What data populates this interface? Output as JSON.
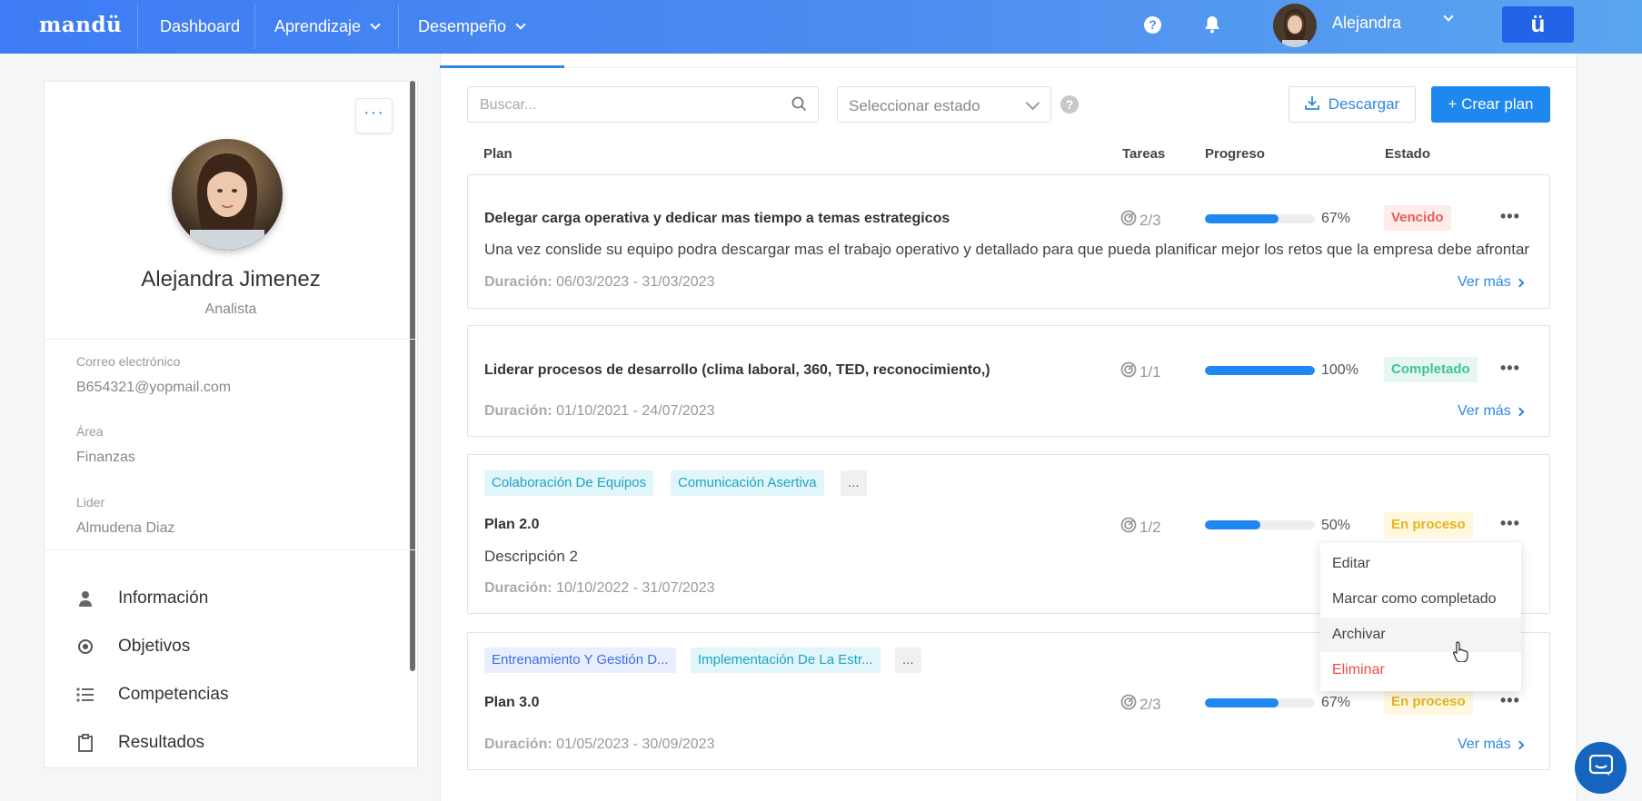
{
  "topbar": {
    "logo": "mandü",
    "nav": [
      {
        "label": "Dashboard"
      },
      {
        "label": "Aprendizaje"
      },
      {
        "label": "Desempeño"
      }
    ],
    "user_name": "Alejandra",
    "brand_badge": "ü"
  },
  "profile": {
    "name": "Alejandra Jimenez",
    "role": "Analista",
    "fields": [
      {
        "label": "Correo electrónico",
        "value": "B654321@yopmail.com"
      },
      {
        "label": "Área",
        "value": "Finanzas"
      },
      {
        "label": "Lider",
        "value": "Almudena Diaz"
      }
    ],
    "menu": [
      {
        "label": "Información",
        "icon": "person-icon"
      },
      {
        "label": "Objetivos",
        "icon": "target-icon"
      },
      {
        "label": "Competencias",
        "icon": "list-icon"
      },
      {
        "label": "Resultados",
        "icon": "clipboard-icon"
      }
    ]
  },
  "toolbar": {
    "search_placeholder": "Buscar...",
    "state_placeholder": "Seleccionar estado",
    "help": "?",
    "download_label": "Descargar",
    "create_label": "+ Crear plan"
  },
  "table": {
    "headers": {
      "plan": "Plan",
      "tasks": "Tareas",
      "progress": "Progreso",
      "state": "Estado"
    },
    "duration_label": "Duración:",
    "more_label": "Ver más",
    "plans": [
      {
        "title": "Delegar carga operativa y dedicar mas tiempo a temas estrategicos",
        "description": "Una vez conslide su equipo podra descargar mas el trabajo operativo y detallado para que pueda planificar mejor los retos que la empresa debe afrontar",
        "duration": "06/03/2023 - 31/03/2023",
        "tasks": "2/3",
        "progress": 67,
        "progress_label": "67%",
        "status": "Vencido",
        "status_color": "#e75c5c",
        "tags": []
      },
      {
        "title": "Liderar procesos de desarrollo (clima laboral, 360, TED, reconocimiento,)",
        "description": "",
        "duration": "01/10/2021 - 24/07/2023",
        "tasks": "1/1",
        "progress": 100,
        "progress_label": "100%",
        "status": "Completado",
        "status_color": "#3fc29c",
        "tags": []
      },
      {
        "title": "Plan 2.0",
        "description": "Descripción 2",
        "duration": "10/10/2022 - 31/07/2023",
        "tasks": "1/2",
        "progress": 50,
        "progress_label": "50%",
        "status": "En proceso",
        "status_color": "#e5b324",
        "tags": [
          "Colaboración De Equipos",
          "Comunicación Asertiva",
          "..."
        ]
      },
      {
        "title": "Plan 3.0",
        "description": "",
        "duration": "01/05/2023 - 30/09/2023",
        "tasks": "2/3",
        "progress": 67,
        "progress_label": "67%",
        "status": "En proceso",
        "status_color": "#e5b324",
        "tags": [
          "Entrenamiento Y Gestión D...",
          "Implementación De La Estr...",
          "..."
        ]
      }
    ]
  },
  "context_menu": {
    "items": [
      "Editar",
      "Marcar como completado",
      "Archivar",
      "Eliminar"
    ],
    "hovered": "Archivar"
  },
  "colors": {
    "accent": "#1e88f0",
    "topbar_start": "#3d7cf4",
    "topbar_end": "#5aa5f0",
    "danger": "#ef4a4a"
  }
}
